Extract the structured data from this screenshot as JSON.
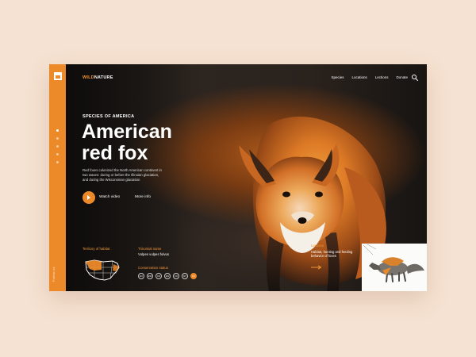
{
  "brand": {
    "word_1": "WILD",
    "word_2": "NATURE"
  },
  "nav": {
    "species": "Species",
    "locations": "Locations",
    "lections": "Lections",
    "donate": "Donate"
  },
  "hero": {
    "eyebrow": "SPECIES OF AMERICA",
    "title_line_1": "American",
    "title_line_2": "red fox",
    "description": "Red foxes colonized the North American continent in two waves: during or before the Illinoian glaciation, and during the Wisconsinan glaciation",
    "watch_label": "Watch video",
    "more_label": "More info"
  },
  "info": {
    "habitat_label": "Territory of habitat",
    "name_label": "Trinomial name",
    "name_value": "Vulpes vulpes fulvus",
    "status_label": "Conservation status",
    "status_codes": [
      "EX",
      "EW",
      "CR",
      "EN",
      "VU",
      "NT",
      "LC"
    ],
    "status_active": "LC",
    "lections_label": "Lections",
    "lections_text": "Habitat, hunting and feeding behavior of foxes"
  },
  "rail": {
    "vertical_text": "Follow us"
  },
  "colors": {
    "accent": "#ec8a2a",
    "background": "#f6e2d2",
    "panel": "#1d1a17"
  },
  "icons": {
    "search": "search-icon",
    "play": "play-icon",
    "arrow": "arrow-right-icon",
    "logo": "logo-icon"
  }
}
